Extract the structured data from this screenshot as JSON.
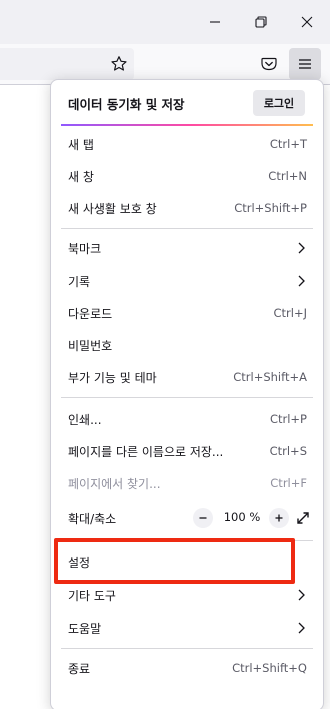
{
  "window": {
    "controls": [
      "minimize-icon",
      "maximize-icon",
      "close-icon"
    ]
  },
  "toolbar": {
    "icons": [
      "star-icon",
      "pocket-icon",
      "hamburger-menu-icon"
    ]
  },
  "menu": {
    "header": {
      "title": "데이터 동기화 및 저장",
      "login": "로그인"
    },
    "items": {
      "new_tab": {
        "label": "새 탭",
        "shortcut": "Ctrl+T"
      },
      "new_window": {
        "label": "새 창",
        "shortcut": "Ctrl+N"
      },
      "new_private": {
        "label": "새 사생활 보호 창",
        "shortcut": "Ctrl+Shift+P"
      },
      "bookmarks": {
        "label": "북마크"
      },
      "history": {
        "label": "기록"
      },
      "downloads": {
        "label": "다운로드",
        "shortcut": "Ctrl+J"
      },
      "passwords": {
        "label": "비밀번호"
      },
      "addons": {
        "label": "부가 기능 및 테마",
        "shortcut": "Ctrl+Shift+A"
      },
      "print": {
        "label": "인쇄...",
        "shortcut": "Ctrl+P"
      },
      "save_page": {
        "label": "페이지를 다른 이름으로 저장...",
        "shortcut": "Ctrl+S"
      },
      "find": {
        "label": "페이지에서 찾기...",
        "shortcut": "Ctrl+F",
        "disabled": true
      },
      "zoom": {
        "label": "확대/축소",
        "minus": "−",
        "value": "100 %",
        "plus": "+"
      },
      "settings": {
        "label": "설정"
      },
      "more_tools": {
        "label": "기타 도구"
      },
      "help": {
        "label": "도움말"
      },
      "exit": {
        "label": "종료",
        "shortcut": "Ctrl+Shift+Q"
      }
    }
  },
  "annotation": {
    "highlighted_item": "설정",
    "color": "#ee2a12"
  }
}
